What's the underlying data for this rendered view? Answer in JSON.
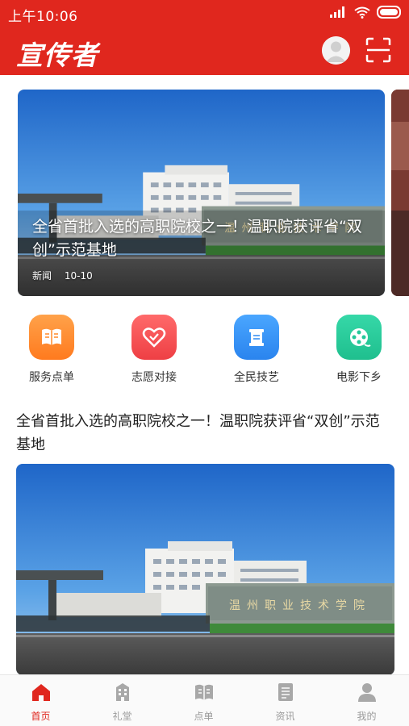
{
  "status_bar": {
    "time": "上午10:06"
  },
  "app_bar": {
    "logo_text": "宣传者"
  },
  "carousel": {
    "slides": [
      {
        "title": "全省首批入选的高职院校之一！温职院获评省“双创”示范基地",
        "category": "新闻",
        "date": "10-10"
      }
    ],
    "sign_text": "温州职业技术学院"
  },
  "quick_menu": [
    {
      "label": "服务点单",
      "icon": "book-icon",
      "color": "#ff8a2a"
    },
    {
      "label": "志愿对接",
      "icon": "heart-icon",
      "color": "#f0464a"
    },
    {
      "label": "全民技艺",
      "icon": "scroll-icon",
      "color": "#2f8cf0"
    },
    {
      "label": "电影下乡",
      "icon": "film-reel-icon",
      "color": "#25c89a"
    }
  ],
  "article": {
    "title": "全省首批入选的高职院校之一！温职院获评省“双创”示范基地"
  },
  "bottom_nav": [
    {
      "label": "首页",
      "icon": "home-icon",
      "active": true
    },
    {
      "label": "礼堂",
      "icon": "hall-icon",
      "active": false
    },
    {
      "label": "点单",
      "icon": "order-book-icon",
      "active": false
    },
    {
      "label": "资讯",
      "icon": "news-icon",
      "active": false
    },
    {
      "label": "我的",
      "icon": "user-icon",
      "active": false
    }
  ],
  "colors": {
    "brand": "#e0271e",
    "nav_inactive": "#9a9a9a"
  }
}
